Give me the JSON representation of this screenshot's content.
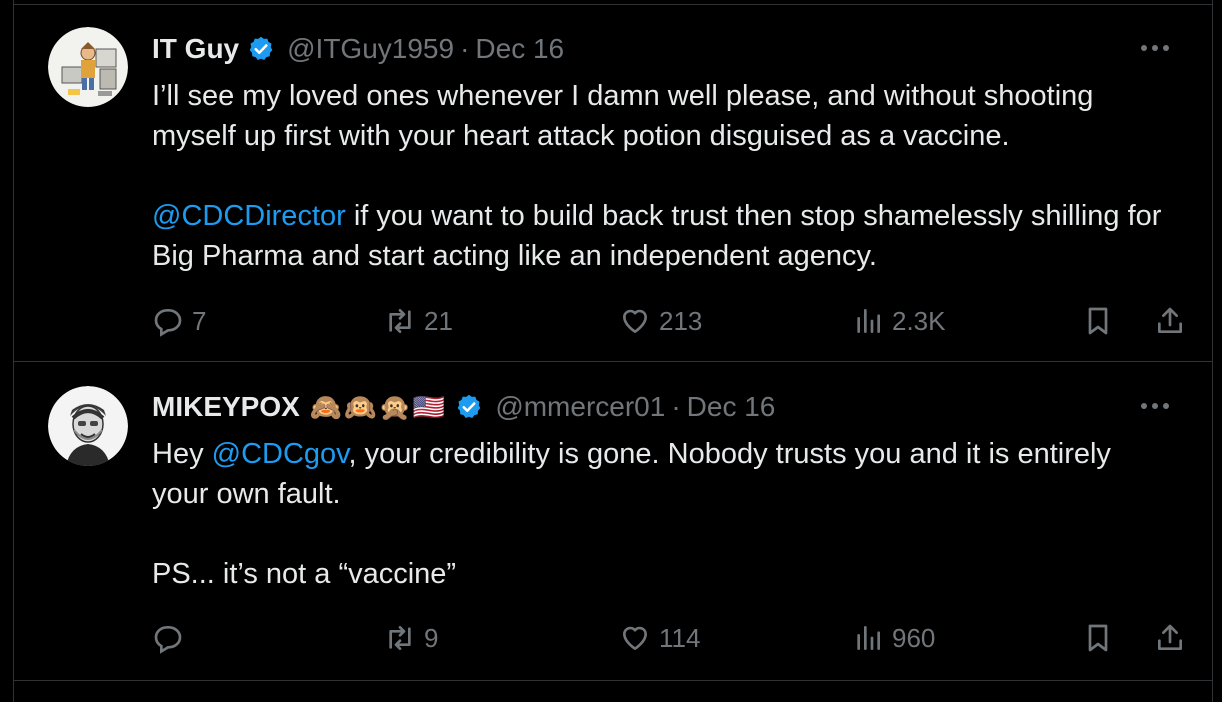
{
  "tweets": [
    {
      "display_name": "IT Guy",
      "handle": "@ITGuy1959",
      "separator": "·",
      "date": "Dec 16",
      "emojis": "",
      "paragraph1_text": "I’ll see my loved ones whenever I damn well please, and without shooting myself up first with your heart attack potion disguised as a vaccine.",
      "paragraph2_mention": "@CDCDirector",
      "paragraph2_text": " if you want to build back trust then stop shamelessly shilling for Big Pharma and start acting like an independent agency.",
      "replies": "7",
      "retweets": "21",
      "likes": "213",
      "views": "2.3K"
    },
    {
      "display_name": "MIKEYPOX",
      "handle": "@mmercer01",
      "separator": "·",
      "date": "Dec 16",
      "emojis": "🙈🙉🙊🇺🇸",
      "paragraph1_prefix": "Hey ",
      "paragraph1_mention": "@CDCgov",
      "paragraph1_text": ", your credibility is gone. Nobody trusts you and it is entirely your own fault.",
      "paragraph2_text": "PS... it’s not a “vaccine”",
      "replies": "",
      "retweets": "9",
      "likes": "114",
      "views": "960"
    }
  ],
  "icons": {
    "verified": "verified-badge-icon",
    "more": "more-options-icon",
    "reply": "reply-icon",
    "retweet": "retweet-icon",
    "like": "heart-icon",
    "views": "views-icon",
    "bookmark": "bookmark-icon",
    "share": "share-icon"
  },
  "colors": {
    "background": "#000000",
    "text": "#e7e9ea",
    "muted": "#71767b",
    "accent": "#1d9bf0",
    "divider": "#2f3336"
  }
}
